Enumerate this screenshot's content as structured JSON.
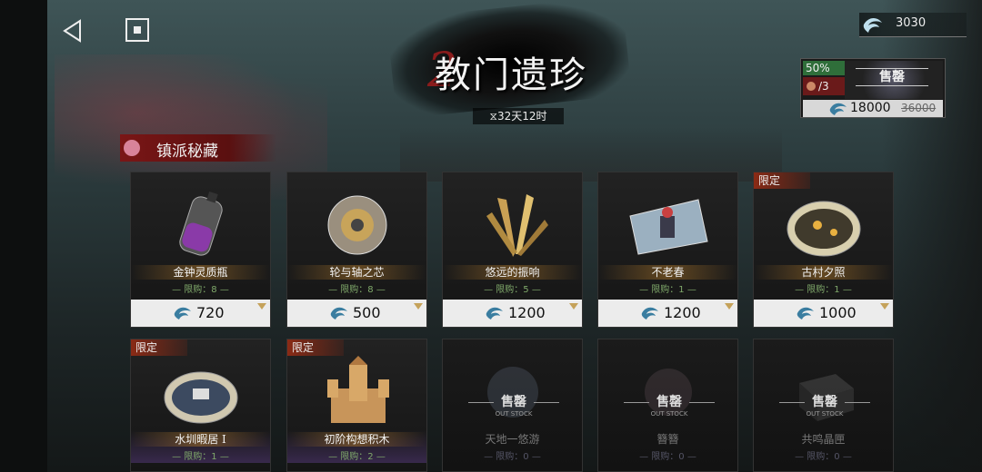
{
  "nav": {
    "back_icon": "back-triangle-icon",
    "home_icon": "stop-square-icon"
  },
  "currency": {
    "amount": "3030",
    "icon": "crystal-gem-icon"
  },
  "banner": {
    "title": "教门遗珍",
    "decor_title": "2",
    "timer": "⧖32天12时"
  },
  "promo": {
    "discount": "50%",
    "count": "/3",
    "sold_label": "售罄",
    "price": "18000",
    "original_price": "36000"
  },
  "section": {
    "label": "镇派秘藏"
  },
  "items": [
    {
      "name": "金钟灵质瓶",
      "limit": "— 限购：8 —",
      "price": "720",
      "tag": ""
    },
    {
      "name": "轮与轴之芯",
      "limit": "— 限购：8 —",
      "price": "500",
      "tag": ""
    },
    {
      "name": "悠远的振响",
      "limit": "— 限购：5 —",
      "price": "1200",
      "tag": ""
    },
    {
      "name": "不老春",
      "limit": "— 限购：1 —",
      "price": "1200",
      "tag": ""
    },
    {
      "name": "古村夕照",
      "limit": "— 限购：1 —",
      "price": "1000",
      "tag": "限定"
    },
    {
      "name": "水圳暇居 I",
      "limit": "— 限购：1 —",
      "tag": "限定"
    },
    {
      "name": "初阶构想积木",
      "limit": "— 限购：2 —",
      "tag": "限定"
    },
    {
      "name": "天地一悠游",
      "limit": "— 限购：0 —",
      "sold": "售罄",
      "sold_en": "OUT STOCK"
    },
    {
      "name": "簪簪",
      "limit": "— 限购：0 —",
      "sold": "售罄",
      "sold_en": "OUT STOCK"
    },
    {
      "name": "共鸣晶匣",
      "limit": "— 限购：0 —",
      "sold": "售罄",
      "sold_en": "OUT STOCK"
    }
  ],
  "colors": {
    "accent_red": "#7a1616",
    "limit_green": "#7fa86a",
    "tag_red": "#8a2a15"
  }
}
